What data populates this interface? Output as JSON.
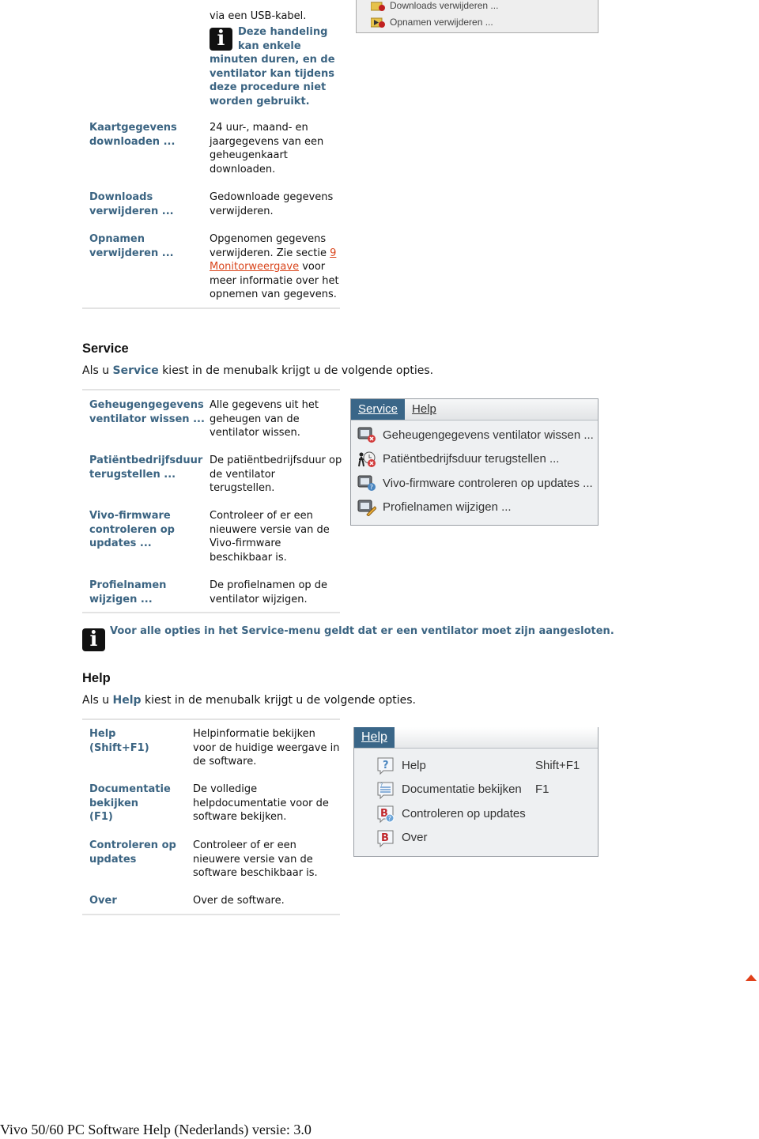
{
  "top_continuation": {
    "text": "via een USB-kabel.",
    "note": "Deze handeling kan enkele minuten duren, en de ventilator kan tijdens deze procedure niet worden gebruikt.",
    "note_line1": "Deze handeling",
    "note_line2": "kan enkele",
    "note_rest": [
      "minuten duren, en de",
      "ventilator kan tijdens",
      "deze procedure niet",
      "worden gebruikt."
    ]
  },
  "top_menu_fragment": {
    "items": [
      "Downloads verwijderen ...",
      "Opnamen verwijderen ..."
    ]
  },
  "file_table": {
    "rows": [
      {
        "term": [
          "Kaartgegevens",
          "downloaden ..."
        ],
        "desc": [
          "24 uur-, maand- en",
          "jaargegevens van een",
          "geheugenkaart",
          "downloaden."
        ]
      },
      {
        "term": [
          "Downloads",
          "verwijderen ..."
        ],
        "desc": [
          "Gedownloade gegevens",
          "verwijderen."
        ]
      },
      {
        "term": [
          "Opnamen",
          "verwijderen ..."
        ],
        "desc_pre1": "Opgenomen gegevens",
        "desc_pre2": "verwijderen. Zie sectie ",
        "link_num": "9",
        "link_text": "Monitorweergave",
        "desc_post1": " voor",
        "desc_post2": "meer informatie over het",
        "desc_post3": "opnemen van gegevens."
      }
    ]
  },
  "service": {
    "heading": "Service",
    "intro_pre": "Als u ",
    "intro_keyword": "Service",
    "intro_post": " kiest in de menubalk krijgt u de volgende opties.",
    "rows": [
      {
        "term": [
          "Geheugengegevens",
          "ventilator wissen ..."
        ],
        "desc": [
          "Alle gegevens uit het",
          "geheugen van de",
          "ventilator wissen."
        ]
      },
      {
        "term": [
          "Patiëntbedrijfsduur",
          "terugstellen ..."
        ],
        "desc": [
          "De patiëntbedrijfsduur op",
          "de ventilator",
          "terugstellen."
        ]
      },
      {
        "term": [
          "Vivo-firmware",
          "controleren op",
          "updates ..."
        ],
        "desc": [
          "Controleer of er een",
          "nieuwere versie van de",
          "Vivo-firmware",
          "beschikbaar is."
        ]
      },
      {
        "term": [
          "Profielnamen",
          "wijzigen ..."
        ],
        "desc": [
          "De profielnamen op de",
          "ventilator wijzigen."
        ]
      }
    ],
    "menu": {
      "tabs": [
        "Service",
        "Help"
      ],
      "items": [
        {
          "label": "Geheugengegevens ventilator wissen ...",
          "icon": "monitor-delete-icon"
        },
        {
          "label": "Patiëntbedrijfsduur terugstellen ...",
          "icon": "patient-clock-reset-icon"
        },
        {
          "label": "Vivo-firmware controleren op updates ...",
          "icon": "monitor-question-icon"
        },
        {
          "label": "Profielnamen wijzigen ...",
          "icon": "monitor-edit-icon"
        }
      ]
    },
    "note": "Voor alle opties in het Service-menu geldt dat er een ventilator moet zijn aangesloten."
  },
  "help": {
    "heading": "Help",
    "intro_pre": "Als u ",
    "intro_keyword": "Help",
    "intro_post": " kiest in de menubalk krijgt u de volgende opties.",
    "rows": [
      {
        "term": [
          "Help",
          "(Shift+F1)"
        ],
        "desc": [
          "Helpinformatie bekijken",
          "voor de huidige weergave in",
          "de software."
        ]
      },
      {
        "term": [
          "Documentatie",
          "bekijken",
          "(F1)"
        ],
        "desc": [
          "De volledige",
          "helpdocumentatie voor de",
          "software bekijken."
        ]
      },
      {
        "term": [
          "Controleren op",
          "updates"
        ],
        "desc": [
          "Controleer of er een",
          "nieuwere versie van de",
          "software beschikbaar is."
        ]
      },
      {
        "term": [
          "Over"
        ],
        "desc": [
          "Over de software."
        ]
      }
    ],
    "menu": {
      "tab": "Help",
      "items": [
        {
          "label": "Help",
          "shortcut": "Shift+F1",
          "icon": "help-question-icon"
        },
        {
          "label": "Documentatie bekijken",
          "shortcut": "F1",
          "icon": "documentation-icon"
        },
        {
          "label": "Controleren op updates",
          "shortcut": "",
          "icon": "check-updates-icon"
        },
        {
          "label": "Over",
          "shortcut": "",
          "icon": "about-icon"
        }
      ]
    }
  },
  "footer": "Vivo 50/60 PC Software Help (Nederlands) versie: 3.0",
  "colors": {
    "term": "#3b6482",
    "link": "#d9451c",
    "menu_active": "#3a6688"
  }
}
